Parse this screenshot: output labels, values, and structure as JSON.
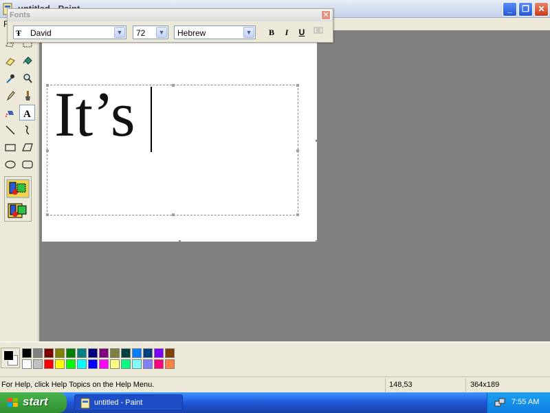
{
  "window": {
    "title": "untitled - Paint"
  },
  "menubar": {
    "first_menu": "F"
  },
  "fonts_toolbar": {
    "title": "Fonts",
    "font_name": "David",
    "font_size": "72",
    "script": "Hebrew",
    "bold_label": "B",
    "italic_label": "I",
    "underline_label": "U"
  },
  "canvas": {
    "typed_text": "It’s"
  },
  "status": {
    "help_text": "For Help, click Help Topics on the Help Menu.",
    "cursor_position": "148,53",
    "selection_size": "364x189"
  },
  "taskbar": {
    "start_label": "start",
    "task_label": "untitled - Paint",
    "clock": "7:55 AM"
  },
  "palette": {
    "foreground": "#000000",
    "background": "#ffffff",
    "colors": [
      "#000000",
      "#808080",
      "#800000",
      "#808000",
      "#008000",
      "#008080",
      "#000080",
      "#800080",
      "#808040",
      "#004040",
      "#0080ff",
      "#004080",
      "#8000ff",
      "#804000",
      "#ffffff",
      "#c0c0c0",
      "#ff0000",
      "#ffff00",
      "#00ff00",
      "#00ffff",
      "#0000ff",
      "#ff00ff",
      "#ffff80",
      "#00ff80",
      "#80ffff",
      "#8080ff",
      "#ff0080",
      "#ff8040"
    ]
  }
}
